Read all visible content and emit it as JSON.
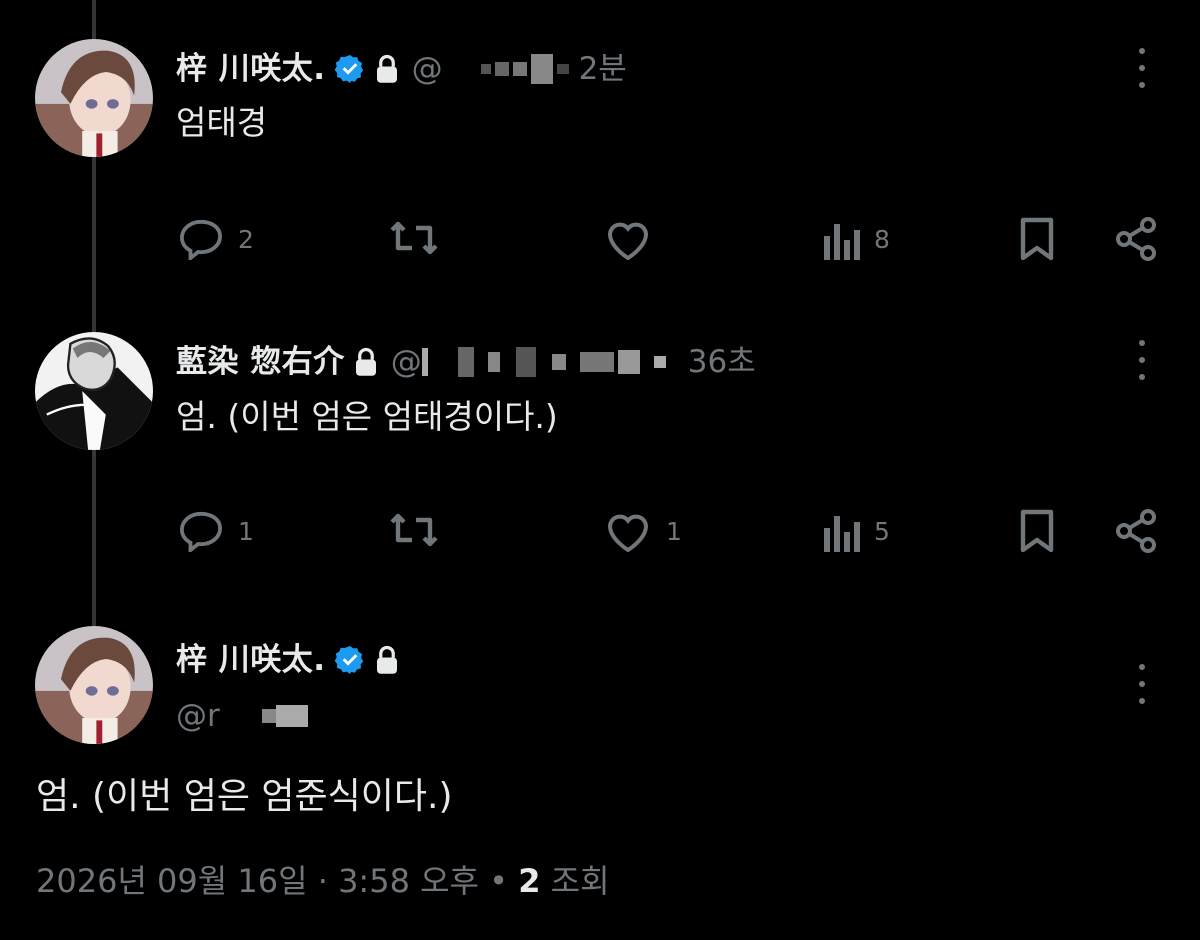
{
  "thread": [
    {
      "name": "梓 川咲太.",
      "verified": true,
      "locked": true,
      "handle": "@",
      "time": "2분",
      "text": "엄태경",
      "replies": "2",
      "retweets": "",
      "likes": "",
      "views": "8"
    },
    {
      "name": "藍染 惣右介",
      "verified": false,
      "locked": true,
      "handle": "@",
      "time": "36초",
      "text": "엄. (이번 엄은 엄태경이다.)",
      "replies": "1",
      "retweets": "",
      "likes": "1",
      "views": "5"
    }
  ],
  "main_tweet": {
    "name": "梓 川咲太.",
    "verified": true,
    "locked": true,
    "handle": "@r",
    "text": "엄. (이번 엄은 엄준식이다.)",
    "date": "2026년 09월 16일",
    "separator": "·",
    "time": "3:58 오후",
    "bullet": "•",
    "views_count": "2",
    "views_label": "조회"
  },
  "colors": {
    "background": "#000000",
    "text_primary": "#e7e9ea",
    "text_secondary": "#71767b",
    "verified_blue": "#1d9bf0",
    "thread_line": "#333639"
  },
  "icons": [
    "reply-icon",
    "retweet-icon",
    "like-icon",
    "views-icon",
    "bookmark-icon",
    "share-icon",
    "more-icon",
    "verified-badge-icon",
    "lock-icon"
  ]
}
